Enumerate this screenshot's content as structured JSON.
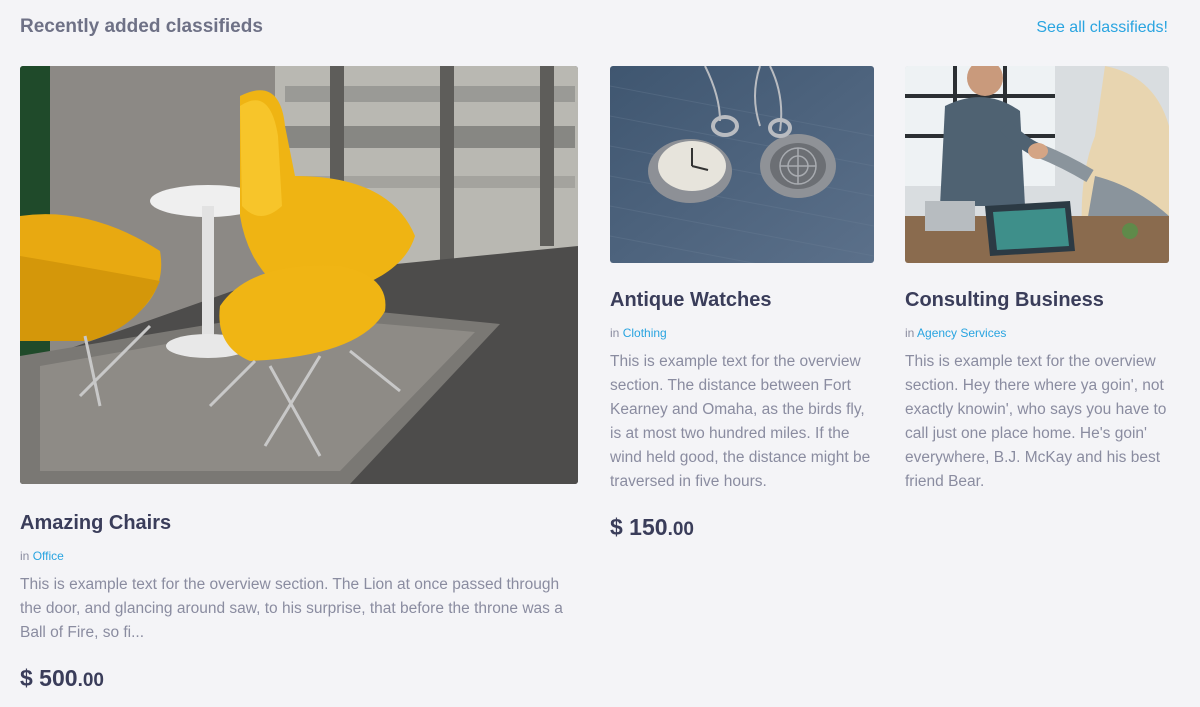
{
  "header": {
    "title": "Recently added classifieds",
    "see_all": "See all classifieds!"
  },
  "colors": {
    "accent": "#29a4e0",
    "heading": "#3a3d5a",
    "muted": "#8a8ca0",
    "background": "#f4f4f7"
  },
  "listings": [
    {
      "title": "Amazing Chairs",
      "in_label": "in",
      "category": "Office",
      "description": "This is example text for the overview section. The Lion at once passed through the door, and glancing around saw, to his surprise, that before the throne was a Ball of Fire, so fi...",
      "price_main": "$ 500",
      "price_cents": ".00",
      "image": "yellow-chairs-photo"
    },
    {
      "title": "Antique Watches",
      "in_label": "in",
      "category": "Clothing",
      "description": "This is example text for the overview section. The distance between Fort Kearney and Omaha, as the birds fly, is at most two hundred miles. If the wind held good, the distance might be traversed in five hours.",
      "price_main": "$ 150",
      "price_cents": ".00",
      "image": "pocket-watches-photo"
    },
    {
      "title": "Consulting Business",
      "in_label": "in",
      "category": "Agency Services",
      "description": "This is example text for the overview section. Hey there where ya goin', not exactly knowin', who says you have to call just one place home. He's goin' everywhere, B.J. McKay and his best friend Bear.",
      "price_main": "",
      "price_cents": "",
      "image": "handshake-photo"
    }
  ]
}
